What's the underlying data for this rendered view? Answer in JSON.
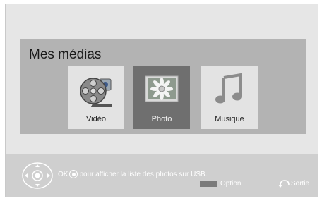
{
  "panel": {
    "title": "Mes médias",
    "tiles": [
      {
        "label": "Vidéo",
        "icon": "film-reel-icon"
      },
      {
        "label": "Photo",
        "icon": "daisy-photo-icon"
      },
      {
        "label": "Musique",
        "icon": "music-note-icon"
      }
    ],
    "selected": "Photo"
  },
  "footer": {
    "ok": "OK",
    "hint": "pour afficher la liste des photos sur USB.",
    "option_label": "Option",
    "exit_label": "Sortie"
  },
  "colors": {
    "background": "#e6e6e6",
    "panel": "#b3b3b3",
    "selected_tile": "#6f6f6f",
    "footer": "#cfcfcf"
  }
}
